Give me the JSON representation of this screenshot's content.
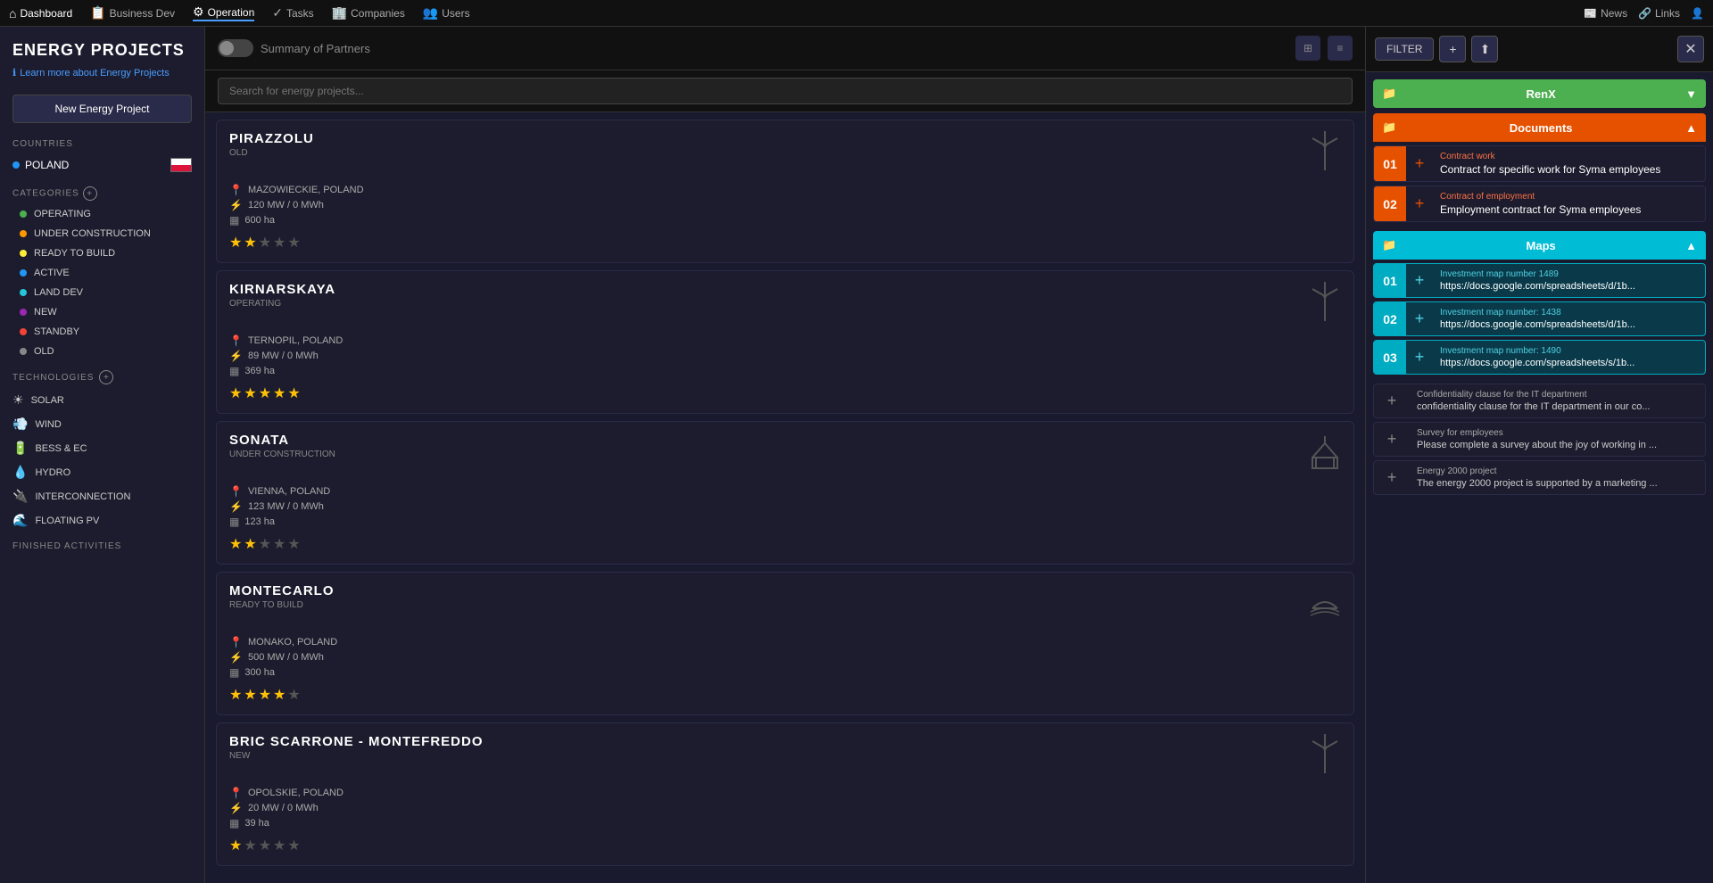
{
  "topnav": {
    "items": [
      {
        "label": "Dashboard",
        "icon": "⌂",
        "active": false
      },
      {
        "label": "Business Dev",
        "icon": "📋",
        "active": false
      },
      {
        "label": "Operation",
        "icon": "⚙",
        "active": true
      },
      {
        "label": "Tasks",
        "icon": "✓",
        "active": false
      },
      {
        "label": "Companies",
        "icon": "🏢",
        "active": false
      },
      {
        "label": "Users",
        "icon": "👥",
        "active": false
      }
    ],
    "right": [
      {
        "label": "News",
        "icon": "📰"
      },
      {
        "label": "Links",
        "icon": "🔗"
      }
    ],
    "user_icon": "👤"
  },
  "sidebar": {
    "title": "ENERGY PROJECTS",
    "info_link": "Learn more about Energy Projects",
    "new_button": "New Energy Project",
    "countries_label": "COUNTRIES",
    "countries": [
      {
        "name": "POLAND",
        "flag": "poland",
        "active": true
      }
    ],
    "categories_label": "CATEGORIES",
    "categories": [
      {
        "name": "OPERATING",
        "dot": "green"
      },
      {
        "name": "UNDER CONSTRUCTION",
        "dot": "orange"
      },
      {
        "name": "READY TO BUILD",
        "dot": "yellow"
      },
      {
        "name": "ACTIVE",
        "dot": "blue"
      },
      {
        "name": "LAND DEV",
        "dot": "teal"
      },
      {
        "name": "NEW",
        "dot": "purple"
      },
      {
        "name": "STANDBY",
        "dot": "red"
      },
      {
        "name": "OLD",
        "dot": "gray"
      }
    ],
    "technologies_label": "TECHNOLOGIES",
    "technologies": [
      {
        "name": "SOLAR",
        "icon": "☀"
      },
      {
        "name": "WIND",
        "icon": "💨"
      },
      {
        "name": "BESS & EC",
        "icon": "🔋"
      },
      {
        "name": "HYDRO",
        "icon": "💧"
      },
      {
        "name": "INTERCONNECTION",
        "icon": "🔌"
      },
      {
        "name": "FLOATING PV",
        "icon": "🌊"
      }
    ],
    "finished_label": "FINISHED ACTIVITIES"
  },
  "center": {
    "header_title": "Summary of Partners",
    "search_placeholder": "Search for energy projects...",
    "projects": [
      {
        "name": "PIRAZZOLU",
        "status": "OLD",
        "location": "MAZOWIECKIE, POLAND",
        "power": "120 MW / 0 MWh",
        "area": "600 ha",
        "stars": 2,
        "icon": "wind_turbine"
      },
      {
        "name": "KIRNARSKAYA",
        "status": "OPERATING",
        "location": "TERNOPIL, POLAND",
        "power": "89 MW / 0 MWh",
        "area": "369 ha",
        "stars": 5,
        "icon": "wind_turbine"
      },
      {
        "name": "SONATA",
        "status": "UNDER CONSTRUCTION",
        "location": "VIENNA, POLAND",
        "power": "123 MW / 0 MWh",
        "area": "123 ha",
        "stars": 2,
        "icon": "construction"
      },
      {
        "name": "MONTECARLO",
        "status": "READY TO BUILD",
        "location": "MONAKO, POLAND",
        "power": "500 MW / 0 MWh",
        "area": "300 ha",
        "stars": 4,
        "icon": "water"
      },
      {
        "name": "BRIC SCARRONE - MONTEFREDDO",
        "status": "NEW",
        "location": "OPOLSKIE, POLAND",
        "power": "20 MW / 0 MWh",
        "area": "39 ha",
        "stars": 1,
        "icon": "wind_turbine"
      }
    ]
  },
  "right_panel": {
    "filter_btn": "FILTER",
    "folders": [
      {
        "id": "renx",
        "name": "RenX",
        "color": "green",
        "expanded": false,
        "items": []
      },
      {
        "id": "documents",
        "name": "Documents",
        "color": "orange",
        "expanded": true,
        "items": [
          {
            "num": "01",
            "type": "Contract work",
            "name": "Contract for specific work for Syma employees"
          },
          {
            "num": "02",
            "type": "Contract of employment",
            "name": "Employment contract for Syma employees"
          }
        ]
      },
      {
        "id": "maps",
        "name": "Maps",
        "color": "cyan",
        "expanded": true,
        "items": [
          {
            "num": "01",
            "title": "Investment map number 1489",
            "url": "https://docs.google.com/spreadsheets/d/1b..."
          },
          {
            "num": "02",
            "title": "Investment map number: 1438",
            "url": "https://docs.google.com/spreadsheets/d/1b..."
          },
          {
            "num": "03",
            "title": "Investment map number: 1490",
            "url": "https://docs.google.com/spreadsheets/s/1b..."
          }
        ]
      }
    ],
    "extra_items": [
      {
        "title": "Confidentiality clause for the IT department",
        "desc": "confidentiality clause for the IT department in our co..."
      },
      {
        "title": "Survey for employees",
        "desc": "Please complete a survey about the joy of working in ..."
      },
      {
        "title": "Energy 2000 project",
        "desc": "The energy 2000 project is supported by a marketing ..."
      }
    ]
  }
}
